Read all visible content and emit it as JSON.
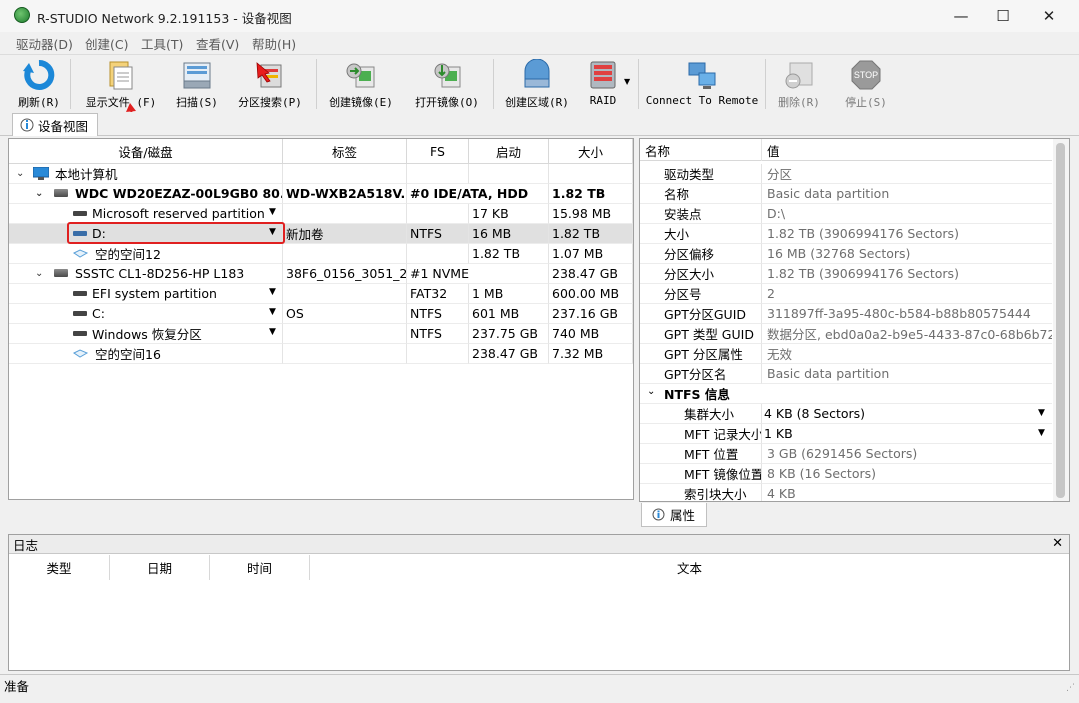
{
  "window": {
    "title": "R-STUDIO Network 9.2.191153 - 设备视图",
    "minimize": "—",
    "maximize": "☐",
    "close": "✕"
  },
  "menu": [
    "驱动器(D)",
    "创建(C)",
    "工具(T)",
    "查看(V)",
    "帮助(H)"
  ],
  "toolbar": {
    "refresh": "刷新(R)",
    "show_files": "显示文件 (F)",
    "scan": "扫描(S)",
    "partition_search": "分区搜索(P)",
    "create_image": "创建镜像(E)",
    "open_image": "打开镜像(O)",
    "create_region": "创建区域(R)",
    "raid": "RAID",
    "connect_remote": "Connect To Remote",
    "delete": "删除(R)",
    "stop": "停止(S)",
    "stop_sign": "STOP"
  },
  "tab": {
    "label": "设备视图"
  },
  "device_table": {
    "headers": [
      "设备/磁盘",
      "标签",
      "FS",
      "启动",
      "大小"
    ],
    "rows": [
      {
        "name": "本地计算机",
        "label": "",
        "fs": "",
        "start": "",
        "size": ""
      },
      {
        "name": "WDC WD20EZAZ-00L9GB0 80.0...",
        "label": "WD-WXB2A518V...",
        "fs": "#0 IDE/ATA, HDD",
        "start": "",
        "size": "1.82 TB"
      },
      {
        "name": "Microsoft reserved partition",
        "label": "",
        "fs": "",
        "start": "17 KB",
        "size": "15.98 MB"
      },
      {
        "name": "D:",
        "label": "新加卷",
        "fs": "NTFS",
        "start": "16 MB",
        "size": "1.82 TB"
      },
      {
        "name": "空的空间12",
        "label": "",
        "fs": "",
        "start": "1.82 TB",
        "size": "1.07 MB"
      },
      {
        "name": "SSSTC CL1-8D256-HP L183",
        "label": "38F6_0156_3051_2...",
        "fs": "#1 NVME",
        "start": "",
        "size": "238.47 GB"
      },
      {
        "name": "EFI system partition",
        "label": "",
        "fs": "FAT32",
        "start": "1 MB",
        "size": "600.00 MB"
      },
      {
        "name": "C:",
        "label": "OS",
        "fs": "NTFS",
        "start": "601 MB",
        "size": "237.16 GB"
      },
      {
        "name": "Windows 恢复分区",
        "label": "",
        "fs": "NTFS",
        "start": "237.75 GB",
        "size": "740 MB"
      },
      {
        "name": "空的空间16",
        "label": "",
        "fs": "",
        "start": "238.47 GB",
        "size": "7.32 MB"
      }
    ]
  },
  "properties": {
    "headers": [
      "名称",
      "值"
    ],
    "rows": [
      {
        "name": "驱动类型",
        "value": "分区"
      },
      {
        "name": "名称",
        "value": "Basic data partition"
      },
      {
        "name": "安装点",
        "value": "D:\\"
      },
      {
        "name": "大小",
        "value": "1.82 TB (3906994176 Sectors)"
      },
      {
        "name": "分区偏移",
        "value": "16 MB (32768 Sectors)"
      },
      {
        "name": "分区大小",
        "value": "1.82 TB (3906994176 Sectors)"
      },
      {
        "name": "分区号",
        "value": "2"
      },
      {
        "name": "GPT分区GUID",
        "value": "311897ff-3a95-480c-b584-b88b80575444"
      },
      {
        "name": "GPT 类型 GUID",
        "value": "数据分区, ebd0a0a2-b9e5-4433-87c0-68b6b72..."
      },
      {
        "name": "GPT 分区属性",
        "value": "无效"
      },
      {
        "name": "GPT分区名",
        "value": "Basic data partition"
      },
      {
        "name": "NTFS 信息",
        "value": ""
      },
      {
        "name": "集群大小",
        "value": "4 KB (8 Sectors)"
      },
      {
        "name": "MFT 记录大小",
        "value": "1 KB"
      },
      {
        "name": "MFT 位置",
        "value": "3 GB (6291456 Sectors)"
      },
      {
        "name": "MFT 镜像位置",
        "value": "8 KB (16 Sectors)"
      },
      {
        "name": "索引块大小",
        "value": "4 KB"
      }
    ],
    "tab_label": "属性"
  },
  "log": {
    "title": "日志",
    "close": "✕",
    "headers": [
      "类型",
      "日期",
      "时间",
      "文本"
    ]
  },
  "status": {
    "text": "准备"
  },
  "colors": {
    "highlight": "#e02020",
    "selected_row": "#e0e0e0",
    "computer_icon": "#2a8ad8"
  }
}
